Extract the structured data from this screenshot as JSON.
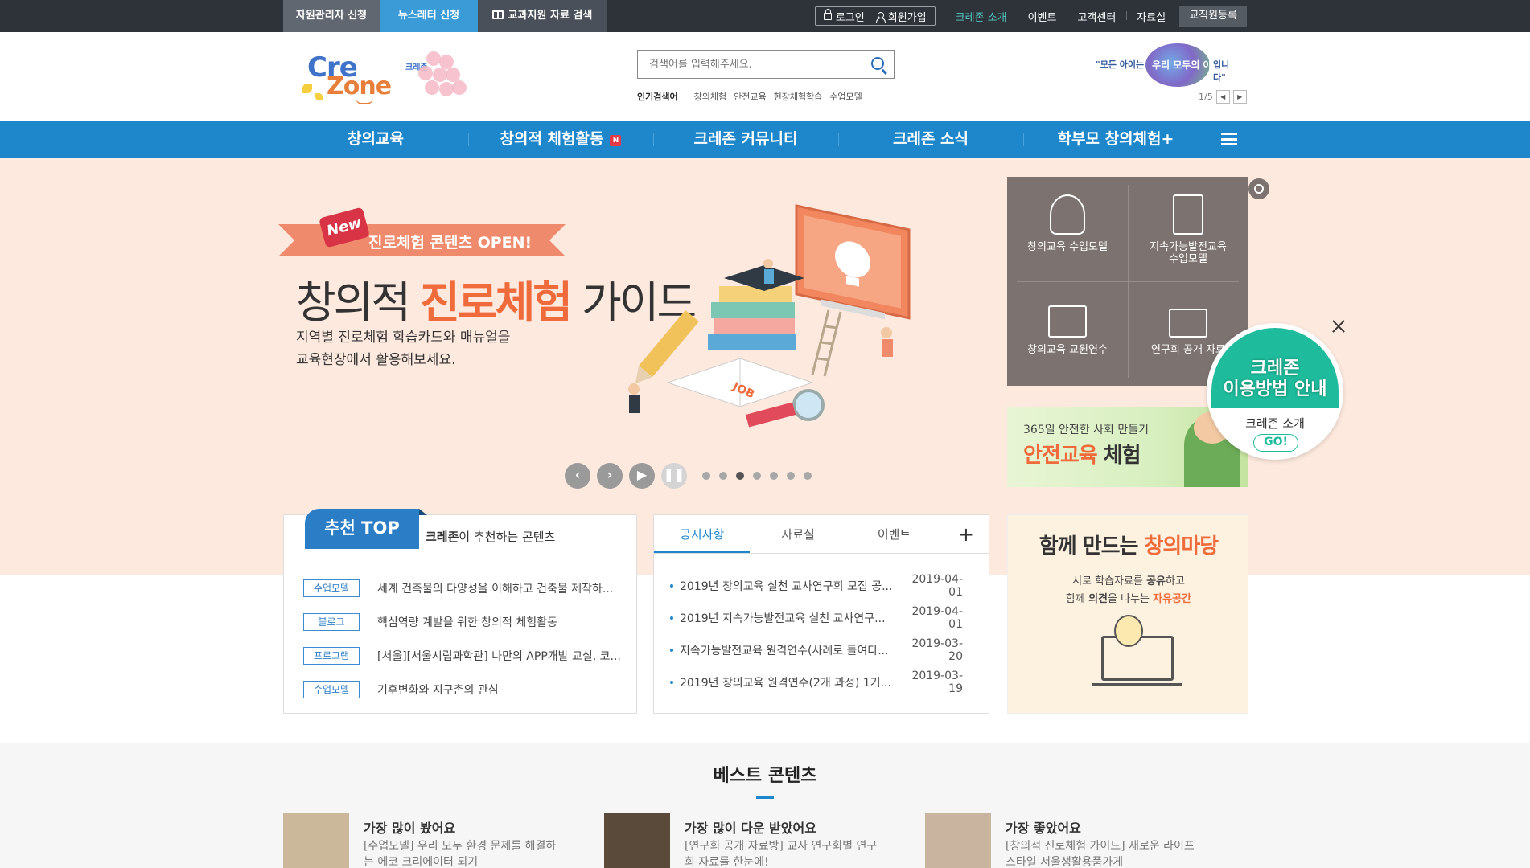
{
  "topbar": {
    "btn_admin": "자원관리자 신청",
    "btn_newsletter": "뉴스레터 신청",
    "btn_textbook": "교과지원 자료 검색",
    "login": "로그인",
    "join": "회원가입",
    "links": [
      "크레존 소개",
      "이벤트",
      "고객센터",
      "자료실"
    ],
    "register": "교직원등록"
  },
  "header": {
    "logo_cre": "Cre",
    "logo_zone": "Zone",
    "logo_kr": "크레존",
    "search_placeholder": "검색어를 입력해주세요.",
    "popular_label": "인기검색어",
    "popular": [
      "창의체험",
      "안전교육",
      "현장체험학습",
      "수업모델"
    ],
    "slogan_pre": "\"모든 아이는",
    "slogan_mid": "우리 모두의 아이",
    "slogan_post": "입니다\"",
    "pager": "1/5"
  },
  "nav": {
    "items": [
      "창의교육",
      "창의적 체험활동",
      "크레존 커뮤니티",
      "크레존 소식",
      "학부모 창의체험+"
    ],
    "new_badge": "N"
  },
  "hero": {
    "new_tag": "New",
    "ribbon": "진로체험 콘텐츠 OPEN!",
    "title_pre": "창의적 ",
    "title_accent": "진로체험",
    "title_post": " 가이드",
    "desc1": "지역별 진로체험 학습카드와 매뉴얼을",
    "desc2": "교육현장에서 활용해보세요.",
    "job_label": "JOB",
    "slides_total": 7,
    "slide_active": 3
  },
  "quick": [
    {
      "label": "창의교육 수업모델",
      "icon": "lightbulb-gear-icon"
    },
    {
      "label": "지속가능발전교육\n수업모델",
      "icon": "document-search-icon"
    },
    {
      "label": "창의교육 교원연수",
      "icon": "monitor-icon"
    },
    {
      "label": "연구회 공개 자료",
      "icon": "presentation-chart-icon"
    }
  ],
  "banner2": {
    "line1": "365일 안전한 사회 만들기",
    "line2_accent": "안전교육",
    "line2_post": " 체험"
  },
  "float_badge": {
    "line1": "크레존",
    "line2": "이용방법 안내",
    "line3": "크레존 소개",
    "go": "GO!"
  },
  "recommend": {
    "tab": "추천 TOP",
    "sub_bold": "크레존",
    "sub_rest": "이 추천하는 콘텐츠",
    "items": [
      {
        "badge": "수업모델",
        "text": "세계 건축물의 다양성을 이해하고 건축물 제작하..."
      },
      {
        "badge": "블로그",
        "text": "핵심역량 계발을 위한 창의적 체험활동"
      },
      {
        "badge": "프로그램",
        "text": "[서울][서울시립과학관] 나만의 APP개발 교실, 코..."
      },
      {
        "badge": "수업모델",
        "text": "기후변화와 지구촌의 관심"
      }
    ]
  },
  "notice": {
    "tabs": [
      "공지사항",
      "자료실",
      "이벤트"
    ],
    "plus": "+",
    "items": [
      {
        "title": "2019년 창의교육 실천 교사연구회 모집 공...",
        "date": "2019-04-01"
      },
      {
        "title": "2019년 지속가능발전교육 실천 교사연구...",
        "date": "2019-04-01"
      },
      {
        "title": "지속가능발전교육 원격연수(사례로 들여다...",
        "date": "2019-03-20"
      },
      {
        "title": "2019년 창의교육 원격연수(2개 과정) 1기...",
        "date": "2019-03-19"
      }
    ]
  },
  "madang": {
    "title_pre": "함께 만드는 ",
    "title_accent": "창의마당",
    "line1_pre": "서로 학습자료를 ",
    "line1_bold": "공유",
    "line1_post": "하고",
    "line2_pre": "함께 ",
    "line2_bold": "의견",
    "line2_mid": "을 나누는 ",
    "line2_accent": "자유공간"
  },
  "best": {
    "title": "베스트 콘텐츠",
    "cards": [
      {
        "title": "가장 많이 봤어요",
        "desc": "[수업모델] 우리 모두 환경 문제를 해결하는 에코 크리에이터 되기"
      },
      {
        "title": "가장 많이 다운 받았어요",
        "desc": "[연구회 공개 자료방] 교사 연구회별 연구회 자료를 한눈에!"
      },
      {
        "title": "가장 좋았어요",
        "desc": "[창의적 진로체험 가이드] 새로운 라이프스타일 서울생활용품가게"
      }
    ]
  },
  "colors": {
    "nav_blue": "#1e86ca",
    "accent_orange": "#f06b3c",
    "hero_bg": "#fde9de",
    "teal": "#1ebc9d"
  }
}
